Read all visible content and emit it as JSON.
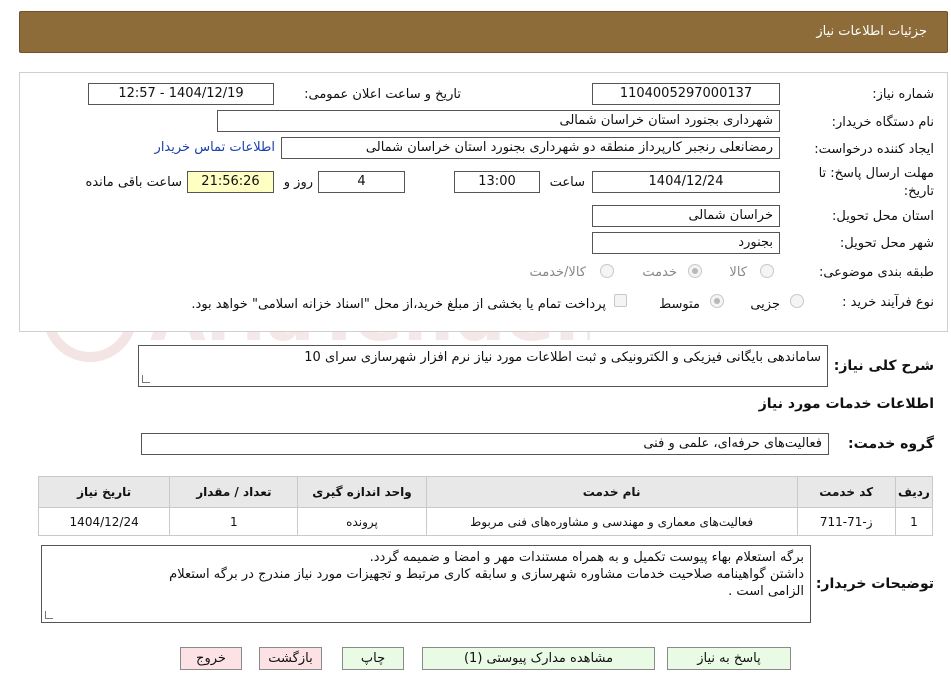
{
  "header": {
    "title": "جزئیات اطلاعات نیاز"
  },
  "fields": {
    "need_number_label": "شماره نیاز:",
    "need_number": "1104005297000137",
    "announce_label": "تاریخ و ساعت اعلان عمومی:",
    "announce_value": "1404/12/19 - 12:57",
    "buyer_org_label": "نام دستگاه خریدار:",
    "buyer_org": "شهرداری بجنورد استان خراسان شمالی",
    "creator_label": "ایجاد کننده درخواست:",
    "creator": "رمضانعلی  رنجبر کارپرداز منطقه دو شهرداری بجنورد استان خراسان شمالی",
    "contact_link": "اطلاعات تماس خریدار",
    "deadline_label_1": "مهلت ارسال پاسخ: تا",
    "deadline_label_2": "تاریخ:",
    "deadline_date": "1404/12/24",
    "time_label": "ساعت",
    "deadline_time": "13:00",
    "days_value": "4",
    "days_label": "روز و",
    "remaining_time": "21:56:26",
    "remaining_label": "ساعت باقی مانده",
    "province_label": "استان محل تحویل:",
    "province": "خراسان شمالی",
    "city_label": "شهر محل تحویل:",
    "city": "بجنورد",
    "category_label": "طبقه بندی موضوعی:",
    "category_options": [
      "کالا",
      "خدمت",
      "کالا/خدمت"
    ],
    "category_selected": "خدمت",
    "process_label": "نوع فرآیند خرید :",
    "process_options": [
      "جزیی",
      "متوسط"
    ],
    "process_selected": "متوسط",
    "payment_note": "پرداخت تمام یا بخشی از مبلغ خرید،از محل \"اسناد خزانه اسلامی\" خواهد بود.",
    "description_label": "شرح کلی نیاز:",
    "description": "ساماندهی بایگانی فیزیکی و الکترونیکی و ثبت اطلاعات مورد نیاز نرم افزار شهرسازی سرای 10"
  },
  "services": {
    "section_title": "اطلاعات خدمات مورد نیاز",
    "group_label": "گروه خدمت:",
    "group_value": "فعالیت‌های حرفه‌ای، علمی و فنی",
    "columns": [
      "ردیف",
      "کد خدمت",
      "نام خدمت",
      "واحد اندازه گیری",
      "تعداد / مقدار",
      "تاریخ نیاز"
    ],
    "rows": [
      [
        "1",
        "ز-71-711",
        "فعالیت‌های معماری و مهندسی و مشاوره‌های فنی مربوط",
        "پرونده",
        "1",
        "1404/12/24"
      ]
    ]
  },
  "buyer_notes": {
    "label": "توضیحات خریدار:",
    "lines": [
      "برگه استعلام بهاء پیوست تکمیل و به همراه مستندات مهر و امضا و ضمیمه گردد.",
      "داشتن گواهینامه صلاحیت خدمات مشاوره شهرسازی و سابقه کاری مرتبط و تجهیزات مورد نیاز مندرج در برگه استعلام",
      "الزامی است ."
    ]
  },
  "buttons": {
    "reply": "پاسخ به نیاز",
    "attachments": "مشاهده مدارک پیوستی (1)",
    "print": "چاپ",
    "back": "بازگشت",
    "exit": "خروج"
  },
  "colors": {
    "header_bg": "#8d6c3a",
    "link": "#1a3fb0",
    "button_green": "#eafbe5",
    "button_pink": "#fde2e5",
    "remaining_bg": "#ffffc4"
  }
}
